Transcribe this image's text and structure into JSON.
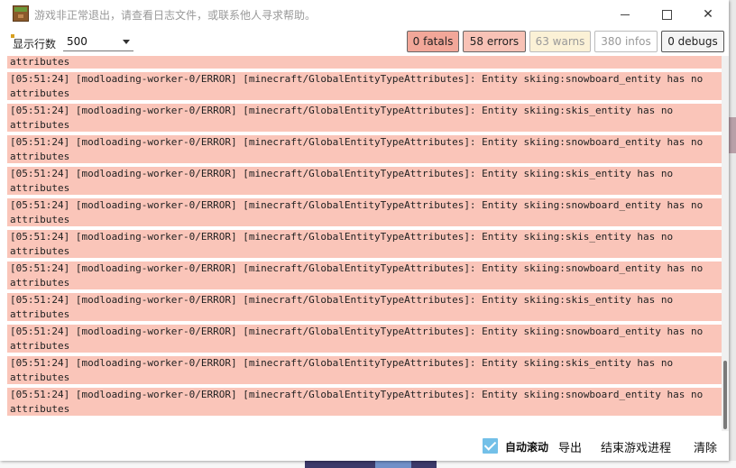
{
  "window": {
    "title": "游戏非正常退出，请查看日志文件，或联系他人寻求帮助。"
  },
  "toolbar": {
    "rows_label": "显示行数",
    "rows_value": "500",
    "filters": {
      "fatals": "0 fatals",
      "errors": "58 errors",
      "warns": "63 warns",
      "infos": "380 infos",
      "debugs": "0 debugs"
    }
  },
  "log": {
    "entries": [
      {
        "line1": "[05:51:24] [modloading-worker-0/ERROR] [minecraft/GlobalEntityTypeAttributes]: Entity skiing:skis_entity has no",
        "line2": "attributes"
      },
      {
        "line1": "[05:51:24] [modloading-worker-0/ERROR] [minecraft/GlobalEntityTypeAttributes]: Entity skiing:snowboard_entity has no",
        "line2": "attributes"
      },
      {
        "line1": "[05:51:24] [modloading-worker-0/ERROR] [minecraft/GlobalEntityTypeAttributes]: Entity skiing:skis_entity has no",
        "line2": "attributes"
      },
      {
        "line1": "[05:51:24] [modloading-worker-0/ERROR] [minecraft/GlobalEntityTypeAttributes]: Entity skiing:snowboard_entity has no",
        "line2": "attributes"
      },
      {
        "line1": "[05:51:24] [modloading-worker-0/ERROR] [minecraft/GlobalEntityTypeAttributes]: Entity skiing:skis_entity has no",
        "line2": "attributes"
      },
      {
        "line1": "[05:51:24] [modloading-worker-0/ERROR] [minecraft/GlobalEntityTypeAttributes]: Entity skiing:snowboard_entity has no",
        "line2": "attributes"
      },
      {
        "line1": "[05:51:24] [modloading-worker-0/ERROR] [minecraft/GlobalEntityTypeAttributes]: Entity skiing:skis_entity has no",
        "line2": "attributes"
      },
      {
        "line1": "[05:51:24] [modloading-worker-0/ERROR] [minecraft/GlobalEntityTypeAttributes]: Entity skiing:snowboard_entity has no",
        "line2": "attributes"
      },
      {
        "line1": "[05:51:24] [modloading-worker-0/ERROR] [minecraft/GlobalEntityTypeAttributes]: Entity skiing:skis_entity has no",
        "line2": "attributes"
      },
      {
        "line1": "[05:51:24] [modloading-worker-0/ERROR] [minecraft/GlobalEntityTypeAttributes]: Entity skiing:snowboard_entity has no",
        "line2": "attributes"
      },
      {
        "line1": "[05:51:24] [modloading-worker-0/ERROR] [minecraft/GlobalEntityTypeAttributes]: Entity skiing:skis_entity has no",
        "line2": "attributes"
      },
      {
        "line1": "[05:51:24] [modloading-worker-0/ERROR] [minecraft/GlobalEntityTypeAttributes]: Entity skiing:snowboard_entity has no",
        "line2": "attributes"
      }
    ]
  },
  "footer": {
    "autoscroll_label": "自动滚动",
    "autoscroll_checked": true,
    "export_label": "导出",
    "kill_label": "结束游戏进程",
    "clear_label": "清除"
  }
}
